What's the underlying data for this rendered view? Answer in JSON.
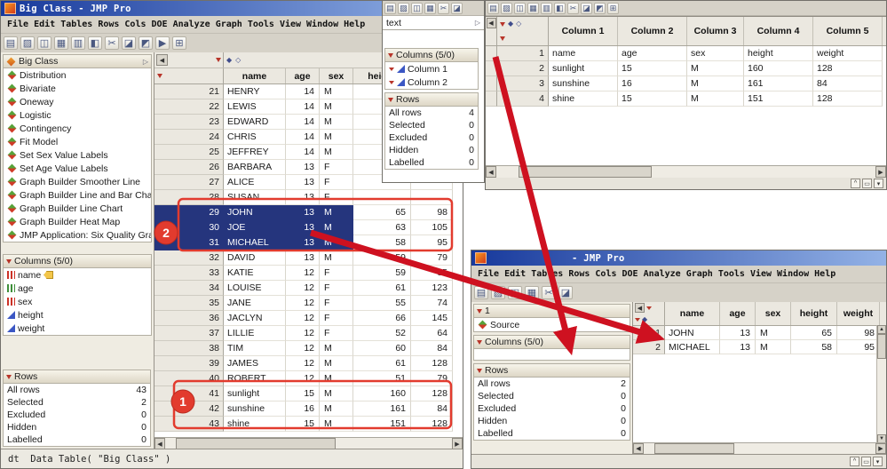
{
  "colors": {
    "titlebar_start": "#17399c",
    "titlebar_end": "#93b2e6",
    "selection": "#25357d",
    "annotation": "#e23b2e",
    "arrow": "#ce1120"
  },
  "glyphs": {
    "scroll_left": "◀",
    "scroll_right": "▶",
    "scroll_up": "▲",
    "scroll_down": "▼",
    "diamond_filled": "◆",
    "diamond_open": "◇",
    "expand_right": "▷"
  },
  "window_buttons": [
    {
      "name": "collapse-up",
      "glyph": "^"
    },
    {
      "name": "panel-layout",
      "glyph": "▭"
    },
    {
      "name": "menu-down",
      "glyph": "▾"
    }
  ],
  "menus": [
    "File",
    "Edit",
    "Tables",
    "Rows",
    "Cols",
    "DOE",
    "Analyze",
    "Graph",
    "Tools",
    "View",
    "Window",
    "Help"
  ],
  "left_window": {
    "title": "Big Class - JMP Pro",
    "toolbar": [
      {
        "name": "new-table-icon",
        "glyph": "▤"
      },
      {
        "name": "open-icon",
        "glyph": "▨"
      },
      {
        "name": "save-icon",
        "glyph": "◫"
      },
      {
        "name": "print-icon",
        "glyph": "▦"
      },
      {
        "name": "preview-icon",
        "glyph": "▥"
      },
      {
        "name": "journal-icon",
        "glyph": "◧"
      },
      {
        "name": "cut-icon",
        "glyph": "✂"
      },
      {
        "name": "copy-icon",
        "glyph": "◪"
      },
      {
        "name": "paste-icon",
        "glyph": "◩"
      },
      {
        "name": "run-script-icon",
        "glyph": "▶"
      },
      {
        "name": "window-grid-icon",
        "glyph": "⊞"
      }
    ],
    "sidebar": {
      "table_panel_title": "Big Class",
      "scripts": [
        "Distribution",
        "Bivariate",
        "Oneway",
        "Logistic",
        "Contingency",
        "Fit Model",
        "Set Sex Value Labels",
        "Set Age Value Labels",
        "Graph Builder Smoother Line",
        "Graph Builder Line and Bar Chart",
        "Graph Builder Line Chart",
        "Graph Builder Heat Map",
        "JMP Application: Six Quality Graph"
      ],
      "columns_panel_title": "Columns (5/0)",
      "columns": [
        {
          "label": "name",
          "type": "nominal",
          "labeled": true
        },
        {
          "label": "age",
          "type": "ordinal"
        },
        {
          "label": "sex",
          "type": "nominal"
        },
        {
          "label": "height",
          "type": "continuous"
        },
        {
          "label": "weight",
          "type": "continuous"
        }
      ],
      "rows_panel_title": "Rows",
      "row_stats": [
        {
          "label": "All rows",
          "value": "43"
        },
        {
          "label": "Selected",
          "value": "2"
        },
        {
          "label": "Excluded",
          "value": "0"
        },
        {
          "label": "Hidden",
          "value": "0"
        },
        {
          "label": "Labelled",
          "value": "0"
        }
      ]
    },
    "grid": {
      "headers": [
        "name",
        "age",
        "sex",
        "height",
        "weight"
      ],
      "rows": [
        {
          "n": "21",
          "name": "HENRY",
          "age": "14",
          "sex": "M",
          "height": "",
          "weight": ""
        },
        {
          "n": "22",
          "name": "LEWIS",
          "age": "14",
          "sex": "M",
          "height": "",
          "weight": ""
        },
        {
          "n": "23",
          "name": "EDWARD",
          "age": "14",
          "sex": "M",
          "height": "",
          "weight": ""
        },
        {
          "n": "24",
          "name": "CHRIS",
          "age": "14",
          "sex": "M",
          "height": "",
          "weight": ""
        },
        {
          "n": "25",
          "name": "JEFFREY",
          "age": "14",
          "sex": "M",
          "height": "",
          "weight": ""
        },
        {
          "n": "26",
          "name": "BARBARA",
          "age": "13",
          "sex": "F",
          "height": "",
          "weight": ""
        },
        {
          "n": "27",
          "name": "ALICE",
          "age": "13",
          "sex": "F",
          "height": "",
          "weight": ""
        },
        {
          "n": "28",
          "name": "SUSAN",
          "age": "13",
          "sex": "F",
          "height": "",
          "weight": ""
        },
        {
          "n": "29",
          "name": "JOHN",
          "age": "13",
          "sex": "M",
          "height": "65",
          "weight": "98",
          "selected": true
        },
        {
          "n": "30",
          "name": "JOE",
          "age": "13",
          "sex": "M",
          "height": "63",
          "weight": "105",
          "selected": true
        },
        {
          "n": "31",
          "name": "MICHAEL",
          "age": "13",
          "sex": "M",
          "height": "58",
          "weight": "95",
          "selected": true
        },
        {
          "n": "32",
          "name": "DAVID",
          "age": "13",
          "sex": "M",
          "height": "59",
          "weight": "79"
        },
        {
          "n": "33",
          "name": "KATIE",
          "age": "12",
          "sex": "F",
          "height": "59",
          "weight": "95"
        },
        {
          "n": "34",
          "name": "LOUISE",
          "age": "12",
          "sex": "F",
          "height": "61",
          "weight": "123"
        },
        {
          "n": "35",
          "name": "JANE",
          "age": "12",
          "sex": "F",
          "height": "55",
          "weight": "74"
        },
        {
          "n": "36",
          "name": "JACLYN",
          "age": "12",
          "sex": "F",
          "height": "66",
          "weight": "145"
        },
        {
          "n": "37",
          "name": "LILLIE",
          "age": "12",
          "sex": "F",
          "height": "52",
          "weight": "64"
        },
        {
          "n": "38",
          "name": "TIM",
          "age": "12",
          "sex": "M",
          "height": "60",
          "weight": "84"
        },
        {
          "n": "39",
          "name": "JAMES",
          "age": "12",
          "sex": "M",
          "height": "61",
          "weight": "128"
        },
        {
          "n": "40",
          "name": "ROBERT",
          "age": "12",
          "sex": "M",
          "height": "51",
          "weight": "79"
        },
        {
          "n": "41",
          "name": "sunlight",
          "age": "15",
          "sex": "M",
          "height": "160",
          "weight": "128"
        },
        {
          "n": "42",
          "name": "sunshine",
          "age": "16",
          "sex": "M",
          "height": "161",
          "weight": "84"
        },
        {
          "n": "43",
          "name": "shine",
          "age": "15",
          "sex": "M",
          "height": "151",
          "weight": "128"
        }
      ]
    },
    "status": "dt  Data Table( \"Big Class\" )"
  },
  "text_window": {
    "title": "text",
    "toolbar": [
      {
        "name": "new-table-icon",
        "glyph": "▤"
      },
      {
        "name": "open-icon",
        "glyph": "▨"
      },
      {
        "name": "save-icon",
        "glyph": "◫"
      },
      {
        "name": "print-icon",
        "glyph": "▦"
      },
      {
        "name": "cut-icon",
        "glyph": "✂"
      },
      {
        "name": "copy-icon",
        "glyph": "◪"
      }
    ],
    "columns_panel_title": "Columns (5/0)",
    "columns": [
      {
        "label": "Column 1",
        "type": "continuous"
      },
      {
        "label": "Column 2",
        "type": "continuous"
      }
    ],
    "rows_panel_title": "Rows",
    "row_stats": [
      {
        "label": "All rows",
        "value": "4"
      },
      {
        "label": "Selected",
        "value": "0"
      },
      {
        "label": "Excluded",
        "value": "0"
      },
      {
        "label": "Hidden",
        "value": "0"
      },
      {
        "label": "Labelled",
        "value": "0"
      }
    ]
  },
  "topright_window": {
    "toolbar": [
      {
        "name": "new-table-icon",
        "glyph": "▤"
      },
      {
        "name": "open-icon",
        "glyph": "▨"
      },
      {
        "name": "save-icon",
        "glyph": "◫"
      },
      {
        "name": "print-icon",
        "glyph": "▦"
      },
      {
        "name": "preview-icon",
        "glyph": "▥"
      },
      {
        "name": "journal-icon",
        "glyph": "◧"
      },
      {
        "name": "cut-icon",
        "glyph": "✂"
      },
      {
        "name": "copy-icon",
        "glyph": "◪"
      },
      {
        "name": "paste-icon",
        "glyph": "◩"
      },
      {
        "name": "window-grid-icon",
        "glyph": "⊞"
      }
    ],
    "grid": {
      "headers": [
        "Column 1",
        "Column 2",
        "Column 3",
        "Column 4",
        "Column 5"
      ],
      "rows": [
        {
          "n": "1",
          "cells": [
            "name",
            "age",
            "sex",
            "height",
            "weight"
          ]
        },
        {
          "n": "2",
          "cells": [
            "sunlight",
            "15",
            "M",
            "160",
            "128"
          ]
        },
        {
          "n": "3",
          "cells": [
            "sunshine",
            "16",
            "M",
            "161",
            "84"
          ]
        },
        {
          "n": "4",
          "cells": [
            "shine",
            "15",
            "M",
            "151",
            "128"
          ]
        }
      ]
    }
  },
  "botright_window": {
    "title": "- JMP Pro",
    "toolbar": [
      {
        "name": "new-table-icon",
        "glyph": "▤"
      },
      {
        "name": "open-icon",
        "glyph": "▨"
      },
      {
        "name": "save-icon",
        "glyph": "◫"
      },
      {
        "name": "print-icon",
        "glyph": "▦"
      },
      {
        "name": "cut-icon",
        "glyph": "✂"
      },
      {
        "name": "copy-icon",
        "glyph": "◪"
      }
    ],
    "panel": {
      "table_title": "1",
      "source_label": "Source",
      "columns_panel_title": "Columns (5/0)",
      "rows_panel_title": "Rows",
      "row_stats": [
        {
          "label": "All rows",
          "value": "2"
        },
        {
          "label": "Selected",
          "value": "0"
        },
        {
          "label": "Excluded",
          "value": "0"
        },
        {
          "label": "Hidden",
          "value": "0"
        },
        {
          "label": "Labelled",
          "value": "0"
        }
      ]
    },
    "grid": {
      "headers": [
        "name",
        "age",
        "sex",
        "height",
        "weight"
      ],
      "rows": [
        {
          "n": "1",
          "name": "JOHN",
          "age": "13",
          "sex": "M",
          "height": "65",
          "weight": "98"
        },
        {
          "n": "2",
          "name": "MICHAEL",
          "age": "13",
          "sex": "M",
          "height": "58",
          "weight": "95"
        }
      ]
    }
  },
  "annotations": {
    "badge_selected_rows": "2",
    "badge_new_rows": "1"
  }
}
